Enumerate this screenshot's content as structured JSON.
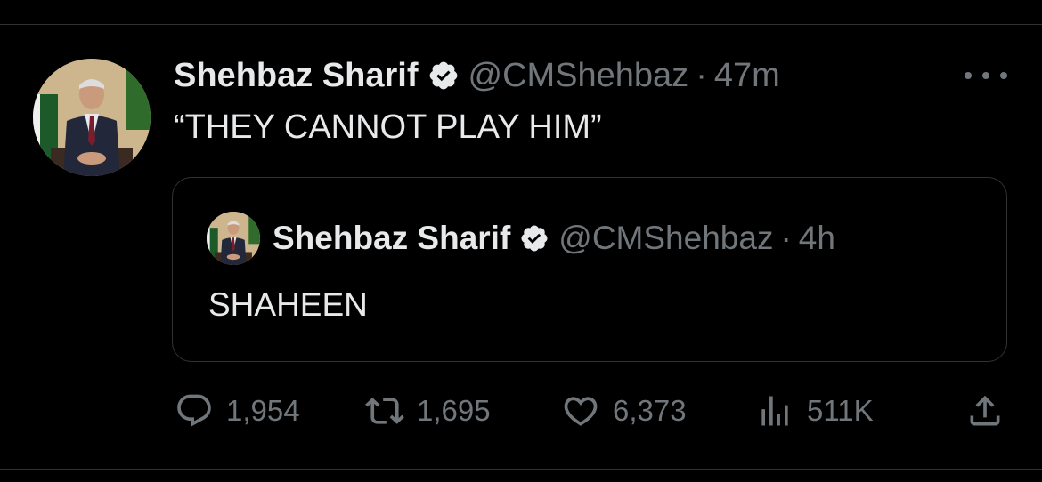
{
  "tweet": {
    "author": {
      "name": "Shehbaz Sharif",
      "handle": "@CMShehbaz",
      "verified_icon": "verified-badge-icon"
    },
    "separator": "·",
    "time": "47m",
    "text": "“THEY CANNOT PLAY HIM”",
    "more_icon": "more-dots-icon"
  },
  "quoted_tweet": {
    "author": {
      "name": "Shehbaz Sharif",
      "handle": "@CMShehbaz"
    },
    "separator": "·",
    "time": "4h",
    "text": "SHAHEEN"
  },
  "actions": {
    "replies": "1,954",
    "retweets": "1,695",
    "likes": "6,373",
    "views": "511K"
  },
  "colors": {
    "background": "#000000",
    "text_primary": "#e7e9ea",
    "text_secondary": "#71767b",
    "border": "#2f3336",
    "verified_badge": "#e7e9ea"
  }
}
